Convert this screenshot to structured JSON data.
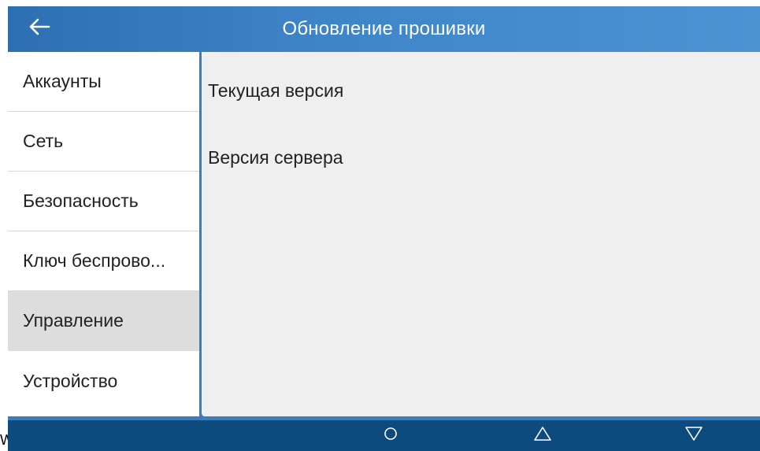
{
  "header": {
    "title": "Обновление прошивки",
    "back_icon": "arrow-left-icon"
  },
  "sidebar": {
    "items": [
      {
        "label": "Аккаунты",
        "active": false
      },
      {
        "label": "Сеть",
        "active": false
      },
      {
        "label": "Безопасность",
        "active": false
      },
      {
        "label": "Ключ беспрово...",
        "active": false
      },
      {
        "label": "Управление",
        "active": true
      },
      {
        "label": "Устройство",
        "active": false
      }
    ]
  },
  "content": {
    "current_version_label": "Текущая версия",
    "server_version_label": "Версия сервера"
  },
  "navbar": {
    "icons": [
      "home-circle-icon",
      "up-triangle-icon",
      "down-triangle-icon"
    ]
  },
  "edge_text": "W",
  "colors": {
    "header": "#3a7dc0",
    "navbar": "#0d4a7e",
    "active_item": "#dddddd",
    "content_bg": "#efefef"
  }
}
